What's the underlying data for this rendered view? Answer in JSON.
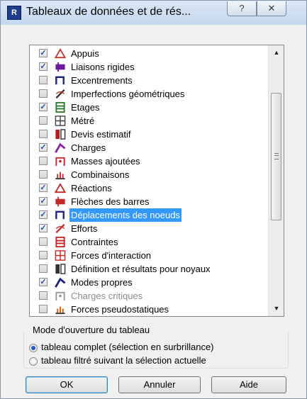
{
  "window": {
    "title": "Tableaux de données et de rés...",
    "icon_text": "R",
    "help_button": "?",
    "close_button": "✕"
  },
  "list": {
    "items": [
      {
        "label": "Appuis",
        "checked": true,
        "icon": "support-icon",
        "color": "#c0392b"
      },
      {
        "label": "Liaisons rigides",
        "checked": true,
        "icon": "rigid-link-icon",
        "color": "#6a1b9a"
      },
      {
        "label": "Excentrements",
        "checked": false,
        "icon": "offset-icon",
        "color": "#1a237e"
      },
      {
        "label": "Imperfections géométriques",
        "checked": false,
        "icon": "imperfection-icon",
        "color": "#333333"
      },
      {
        "label": "Etages",
        "checked": true,
        "icon": "storeys-icon",
        "color": "#2e7d32"
      },
      {
        "label": "Métré",
        "checked": false,
        "icon": "takeoff-icon",
        "color": "#444444"
      },
      {
        "label": "Devis estimatif",
        "checked": false,
        "icon": "estimate-icon",
        "color": "#b71c1c"
      },
      {
        "label": "Charges",
        "checked": true,
        "icon": "loads-icon",
        "color": "#8e24aa"
      },
      {
        "label": "Masses ajoutées",
        "checked": false,
        "icon": "added-mass-icon",
        "color": "#c62828"
      },
      {
        "label": "Combinaisons",
        "checked": false,
        "icon": "combinations-icon",
        "color": "#c62828"
      },
      {
        "label": "Réactions",
        "checked": true,
        "icon": "reactions-icon",
        "color": "#c62828"
      },
      {
        "label": "Flèches des barres",
        "checked": true,
        "icon": "deflections-icon",
        "color": "#c62828"
      },
      {
        "label": "Déplacements des noeuds",
        "checked": true,
        "icon": "displacements-icon",
        "color": "#1a237e",
        "selected": true
      },
      {
        "label": "Efforts",
        "checked": true,
        "icon": "forces-icon",
        "color": "#c62828"
      },
      {
        "label": "Contraintes",
        "checked": false,
        "icon": "stresses-icon",
        "color": "#c62828"
      },
      {
        "label": "Forces d'interaction",
        "checked": false,
        "icon": "interaction-forces-icon",
        "color": "#c62828"
      },
      {
        "label": "Définition et résultats pour noyaux",
        "checked": false,
        "icon": "core-walls-icon",
        "color": "#333333"
      },
      {
        "label": "Modes propres",
        "checked": true,
        "icon": "eigenmodes-icon",
        "color": "#1a237e"
      },
      {
        "label": "Charges critiques",
        "checked": false,
        "icon": "critical-loads-icon",
        "color": "#999999",
        "disabled": true
      },
      {
        "label": "Forces pseudostatiques",
        "checked": false,
        "icon": "pseudostatic-forces-icon",
        "color": "#e65100"
      }
    ]
  },
  "mode": {
    "title": "Mode d'ouverture du tableau",
    "options": [
      {
        "label": "tableau complet (sélection en surbrillance)",
        "selected": true
      },
      {
        "label": "tableau filtré suivant la sélection actuelle",
        "selected": false
      }
    ]
  },
  "buttons": {
    "ok": "OK",
    "cancel": "Annuler",
    "help": "Aide"
  }
}
